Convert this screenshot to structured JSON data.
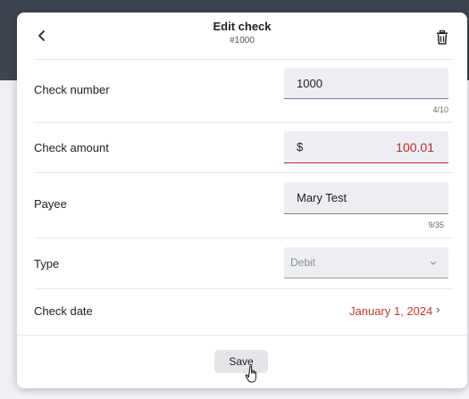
{
  "dialog": {
    "title": "Edit check",
    "subtitle": "#1000"
  },
  "icons": {
    "back": "chevron-left-icon",
    "delete": "trash-icon",
    "date_chevron": "chevron-right-icon",
    "type_chevron": "chevron-down-icon"
  },
  "check_number": {
    "label": "Check number",
    "value": "1000",
    "counter": "4/10"
  },
  "check_amount": {
    "label": "Check amount",
    "currency": "$",
    "value": "100.01"
  },
  "payee": {
    "label": "Payee",
    "value": "Mary Test",
    "counter": "9/35"
  },
  "type": {
    "label": "Type",
    "value": "Debit"
  },
  "check_date": {
    "label": "Check date",
    "value": "January 1, 2024",
    "chevron": "›"
  },
  "footer": {
    "save_label": "Save"
  },
  "colors": {
    "accent_error": "#c62828",
    "header_bg": "#3c4550"
  }
}
